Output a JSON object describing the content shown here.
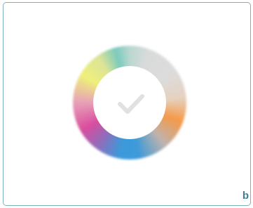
{
  "colors": {
    "border": "#7fb1bd",
    "check": "#e1e1e1",
    "corner_label": "#3e7f96",
    "ring_stops": [
      "#7bcbbd",
      "#dcdcdc",
      "#f59a4a",
      "#3a9adb",
      "#d94d9e",
      "#eef07a"
    ]
  },
  "icons": {
    "center": "checkmark-icon"
  },
  "labels": {
    "corner": "b"
  }
}
